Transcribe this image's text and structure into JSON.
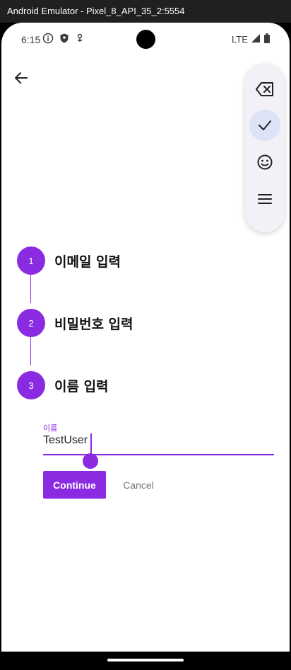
{
  "window": {
    "title": "Android Emulator - Pixel_8_API_35_2:5554"
  },
  "status_bar": {
    "time": "6:15",
    "network": "LTE"
  },
  "steps": [
    {
      "number": "1",
      "title": "이메일 입력"
    },
    {
      "number": "2",
      "title": "비밀번호 입력"
    },
    {
      "number": "3",
      "title": "이름 입력"
    }
  ],
  "name_field": {
    "label": "이름",
    "value": "TestUser"
  },
  "buttons": {
    "continue": "Continue",
    "cancel": "Cancel"
  },
  "floating_toolbar": {
    "items": [
      "backspace-icon",
      "check-icon",
      "emoji-icon",
      "menu-icon"
    ],
    "selected": "check-icon"
  },
  "colors": {
    "accent": "#8a2be2",
    "toolbar_bg": "#f3f1f7",
    "selected_bg": "#dde3f7"
  }
}
